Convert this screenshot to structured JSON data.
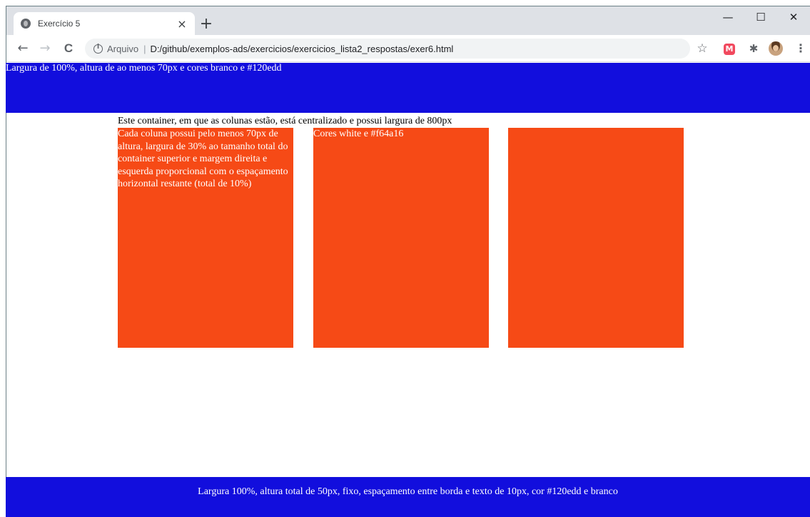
{
  "browser": {
    "tab": {
      "title": "Exercício 5",
      "close_glyph": "×",
      "favicon": "globe-icon"
    },
    "new_tab_glyph": "+",
    "window_controls": {
      "minimize": "—",
      "maximize": "☐",
      "close": "✕"
    },
    "nav": {
      "back": "←",
      "forward": "→",
      "reload": "C"
    },
    "omnibox": {
      "scheme_label": "Arquivo",
      "separator": "|",
      "url": "D:/github/exemplos-ads/exercicios/exercicios_lista2_respostas/exer6.html"
    },
    "toolbar_icons": {
      "bookmark": "☆",
      "extension_m": "M",
      "extensions": "✱",
      "menu": "⋮"
    }
  },
  "page": {
    "header_text": "Largura de 100%, altura de ao menos 70px e cores branco e #120edd",
    "container_caption": "Este container, em que as colunas estão, está centralizado e possui largura de 800px",
    "columns": [
      {
        "text": "Cada coluna possui pelo menos 70px de altura, largura de 30% ao tamanho total do container superior e margem direita e esquerda proporcional com o espaçamento horizontal restante (total de 10%)"
      },
      {
        "text": "Cores white e #f64a16"
      },
      {
        "text": ""
      }
    ],
    "footer_text": "Largura 100%, altura total de 50px, fixo, espaçamento entre borda e texto de 10px, cor #120edd e branco"
  },
  "colors": {
    "header_bg": "#120edd",
    "column_bg": "#f64a16",
    "footer_bg": "#120edd",
    "text_light": "#ffffff"
  }
}
